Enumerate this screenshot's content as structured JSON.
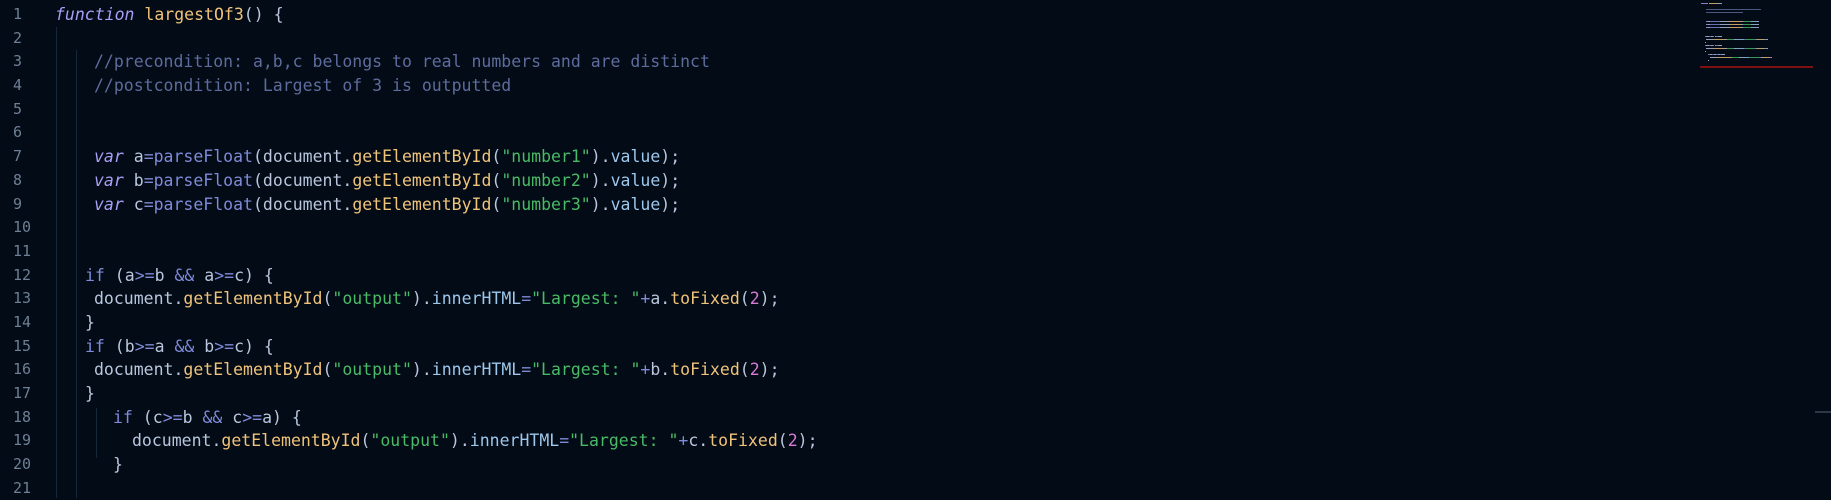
{
  "editor": {
    "lines": [
      {
        "n": "1",
        "indent": 55,
        "tokens": [
          {
            "t": "function",
            "c": "kw-italic"
          },
          {
            "t": " ",
            "c": "ident"
          },
          {
            "t": "largestOf3",
            "c": "fn"
          },
          {
            "t": "() {",
            "c": "punc"
          }
        ]
      },
      {
        "n": "2",
        "indent": 55,
        "tokens": []
      },
      {
        "n": "3",
        "indent": 94,
        "tokens": [
          {
            "t": "//precondition: a,b,c belongs to real numbers and are distinct",
            "c": "cmt"
          }
        ]
      },
      {
        "n": "4",
        "indent": 94,
        "tokens": [
          {
            "t": "//postcondition: Largest of 3 is outputted",
            "c": "cmt"
          }
        ]
      },
      {
        "n": "5",
        "indent": 94,
        "tokens": []
      },
      {
        "n": "6",
        "indent": 94,
        "tokens": []
      },
      {
        "n": "7",
        "indent": 94,
        "tokens": [
          {
            "t": "var",
            "c": "kw-italic"
          },
          {
            "t": " a",
            "c": "ident"
          },
          {
            "t": "=",
            "c": "op"
          },
          {
            "t": "parseFloat",
            "c": "kw"
          },
          {
            "t": "(document.",
            "c": "punc"
          },
          {
            "t": "getElementById",
            "c": "fn"
          },
          {
            "t": "(",
            "c": "punc"
          },
          {
            "t": "\"number1\"",
            "c": "str"
          },
          {
            "t": ").",
            "c": "punc"
          },
          {
            "t": "value",
            "c": "prop"
          },
          {
            "t": ");",
            "c": "punc"
          }
        ]
      },
      {
        "n": "8",
        "indent": 94,
        "tokens": [
          {
            "t": "var",
            "c": "kw-italic"
          },
          {
            "t": " b",
            "c": "ident"
          },
          {
            "t": "=",
            "c": "op"
          },
          {
            "t": "parseFloat",
            "c": "kw"
          },
          {
            "t": "(document.",
            "c": "punc"
          },
          {
            "t": "getElementById",
            "c": "fn"
          },
          {
            "t": "(",
            "c": "punc"
          },
          {
            "t": "\"number2\"",
            "c": "str"
          },
          {
            "t": ").",
            "c": "punc"
          },
          {
            "t": "value",
            "c": "prop"
          },
          {
            "t": ");",
            "c": "punc"
          }
        ]
      },
      {
        "n": "9",
        "indent": 94,
        "tokens": [
          {
            "t": "var",
            "c": "kw-italic"
          },
          {
            "t": " c",
            "c": "ident"
          },
          {
            "t": "=",
            "c": "op"
          },
          {
            "t": "parseFloat",
            "c": "kw"
          },
          {
            "t": "(document.",
            "c": "punc"
          },
          {
            "t": "getElementById",
            "c": "fn"
          },
          {
            "t": "(",
            "c": "punc"
          },
          {
            "t": "\"number3\"",
            "c": "str"
          },
          {
            "t": ").",
            "c": "punc"
          },
          {
            "t": "value",
            "c": "prop"
          },
          {
            "t": ");",
            "c": "punc"
          }
        ]
      },
      {
        "n": "10",
        "indent": 94,
        "tokens": []
      },
      {
        "n": "11",
        "indent": 94,
        "tokens": []
      },
      {
        "n": "12",
        "indent": 85,
        "tokens": [
          {
            "t": "if",
            "c": "kw"
          },
          {
            "t": " (a",
            "c": "punc"
          },
          {
            "t": ">=",
            "c": "op"
          },
          {
            "t": "b ",
            "c": "ident"
          },
          {
            "t": "&&",
            "c": "op"
          },
          {
            "t": " a",
            "c": "ident"
          },
          {
            "t": ">=",
            "c": "op"
          },
          {
            "t": "c) {",
            "c": "punc"
          }
        ]
      },
      {
        "n": "13",
        "indent": 94,
        "tokens": [
          {
            "t": "document.",
            "c": "ident"
          },
          {
            "t": "getElementById",
            "c": "fn"
          },
          {
            "t": "(",
            "c": "punc"
          },
          {
            "t": "\"output\"",
            "c": "str"
          },
          {
            "t": ").",
            "c": "punc"
          },
          {
            "t": "innerHTML",
            "c": "prop"
          },
          {
            "t": "=",
            "c": "op"
          },
          {
            "t": "\"Largest: \"",
            "c": "str"
          },
          {
            "t": "+",
            "c": "op"
          },
          {
            "t": "a.",
            "c": "ident"
          },
          {
            "t": "toFixed",
            "c": "fn"
          },
          {
            "t": "(",
            "c": "punc"
          },
          {
            "t": "2",
            "c": "num"
          },
          {
            "t": ");",
            "c": "punc"
          }
        ]
      },
      {
        "n": "14",
        "indent": 85,
        "tokens": [
          {
            "t": "}",
            "c": "punc"
          }
        ]
      },
      {
        "n": "15",
        "indent": 85,
        "tokens": [
          {
            "t": "if",
            "c": "kw"
          },
          {
            "t": " (b",
            "c": "punc"
          },
          {
            "t": ">=",
            "c": "op"
          },
          {
            "t": "a ",
            "c": "ident"
          },
          {
            "t": "&&",
            "c": "op"
          },
          {
            "t": " b",
            "c": "ident"
          },
          {
            "t": ">=",
            "c": "op"
          },
          {
            "t": "c) {",
            "c": "punc"
          }
        ]
      },
      {
        "n": "16",
        "indent": 94,
        "tokens": [
          {
            "t": "document.",
            "c": "ident"
          },
          {
            "t": "getElementById",
            "c": "fn"
          },
          {
            "t": "(",
            "c": "punc"
          },
          {
            "t": "\"output\"",
            "c": "str"
          },
          {
            "t": ").",
            "c": "punc"
          },
          {
            "t": "innerHTML",
            "c": "prop"
          },
          {
            "t": "=",
            "c": "op"
          },
          {
            "t": "\"Largest: \"",
            "c": "str"
          },
          {
            "t": "+",
            "c": "op"
          },
          {
            "t": "b.",
            "c": "ident"
          },
          {
            "t": "toFixed",
            "c": "fn"
          },
          {
            "t": "(",
            "c": "punc"
          },
          {
            "t": "2",
            "c": "num"
          },
          {
            "t": ");",
            "c": "punc"
          }
        ]
      },
      {
        "n": "17",
        "indent": 85,
        "tokens": [
          {
            "t": "}",
            "c": "punc"
          }
        ]
      },
      {
        "n": "18",
        "indent": 113,
        "tokens": [
          {
            "t": "if",
            "c": "kw"
          },
          {
            "t": " (c",
            "c": "punc"
          },
          {
            "t": ">=",
            "c": "op"
          },
          {
            "t": "b ",
            "c": "ident"
          },
          {
            "t": "&&",
            "c": "op"
          },
          {
            "t": " c",
            "c": "ident"
          },
          {
            "t": ">=",
            "c": "op"
          },
          {
            "t": "a) {",
            "c": "punc"
          }
        ]
      },
      {
        "n": "19",
        "indent": 132,
        "tokens": [
          {
            "t": "document.",
            "c": "ident"
          },
          {
            "t": "getElementById",
            "c": "fn"
          },
          {
            "t": "(",
            "c": "punc"
          },
          {
            "t": "\"output\"",
            "c": "str"
          },
          {
            "t": ").",
            "c": "punc"
          },
          {
            "t": "innerHTML",
            "c": "prop"
          },
          {
            "t": "=",
            "c": "op"
          },
          {
            "t": "\"Largest: \"",
            "c": "str"
          },
          {
            "t": "+",
            "c": "op"
          },
          {
            "t": "c.",
            "c": "ident"
          },
          {
            "t": "toFixed",
            "c": "fn"
          },
          {
            "t": "(",
            "c": "punc"
          },
          {
            "t": "2",
            "c": "num"
          },
          {
            "t": ");",
            "c": "punc"
          }
        ]
      },
      {
        "n": "20",
        "indent": 113,
        "tokens": [
          {
            "t": "}",
            "c": "punc"
          }
        ]
      },
      {
        "n": "21",
        "indent": 94,
        "tokens": []
      }
    ]
  },
  "colors": {
    "background": "#020b16",
    "line_number": "#6f7f95",
    "comment": "#5e6c9d",
    "string": "#49bb66",
    "function": "#f0c37a",
    "keyword": "#a99df4",
    "number": "#d67ad8"
  }
}
